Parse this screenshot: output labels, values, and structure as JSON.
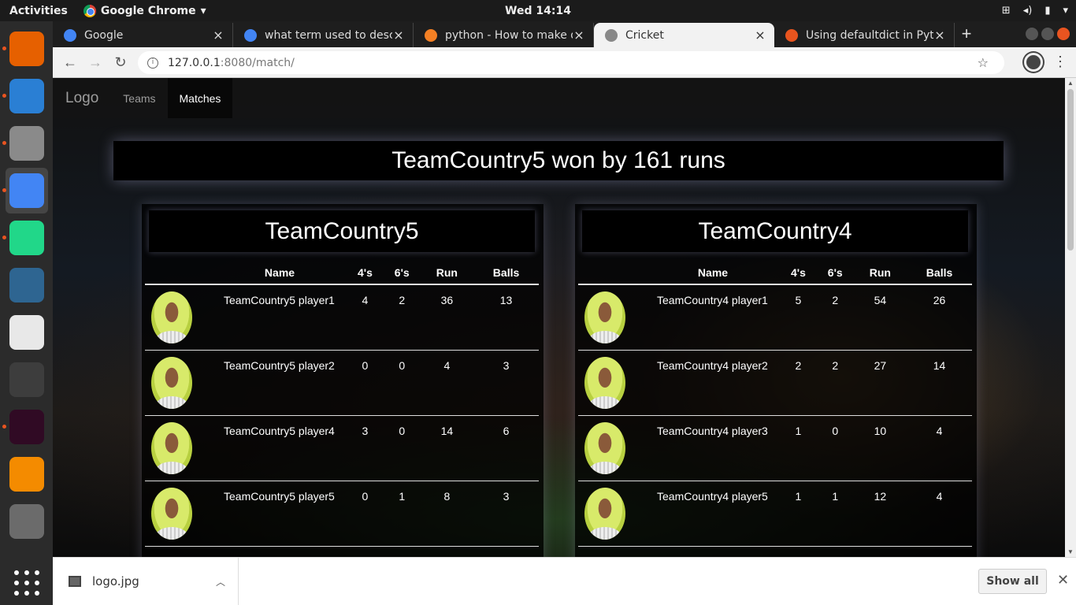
{
  "os": {
    "activities": "Activities",
    "app_menu": "Google Chrome",
    "app_menu_caret": "▾",
    "clock": "Wed 14:14"
  },
  "dock": {
    "items": [
      {
        "name": "firefox",
        "color": "#e66000",
        "active": false
      },
      {
        "name": "thunderbird",
        "color": "#2a7fd4",
        "active": false
      },
      {
        "name": "files",
        "color": "#8a8a8a",
        "active": false
      },
      {
        "name": "chrome",
        "color": "#4285f4",
        "active": true
      },
      {
        "name": "pycharm",
        "color": "#21d789",
        "active": false
      },
      {
        "name": "mysql-workbench",
        "color": "#2e6591",
        "active": false
      },
      {
        "name": "evince",
        "color": "#e8e8e8",
        "active": false
      },
      {
        "name": "sublime-text",
        "color": "#3d3d3d",
        "active": false
      },
      {
        "name": "terminal",
        "color": "#300a24",
        "active": false
      },
      {
        "name": "vlc",
        "color": "#f48b00",
        "active": false
      },
      {
        "name": "text-editor",
        "color": "#6b6b6b",
        "active": false
      }
    ]
  },
  "browser": {
    "tabs": [
      {
        "title": "Google",
        "icon_color": "#4285f4",
        "active": false
      },
      {
        "title": "what term used to desc",
        "icon_color": "#4285f4",
        "active": false
      },
      {
        "title": "python - How to make di",
        "icon_color": "#f48024",
        "active": false
      },
      {
        "title": "Cricket",
        "icon_color": "#888888",
        "active": true
      },
      {
        "title": "Using defaultdict in Pyt",
        "icon_color": "#e8541e",
        "active": false
      }
    ],
    "close_glyph": "×",
    "new_tab_glyph": "+",
    "url_host": "127.0.0.1",
    "url_rest": ":8080/match/"
  },
  "site": {
    "brand": "Logo",
    "nav": [
      {
        "label": "Teams",
        "active": false
      },
      {
        "label": "Matches",
        "active": true
      }
    ],
    "result": "TeamCountry5 won by 161 runs",
    "columns": {
      "name": "Name",
      "fours": "4's",
      "sixes": "6's",
      "runs": "Run",
      "balls": "Balls"
    },
    "teams": [
      {
        "name": "TeamCountry5",
        "players": [
          {
            "name": "TeamCountry5 player1",
            "fours": "4",
            "sixes": "2",
            "runs": "36",
            "balls": "13"
          },
          {
            "name": "TeamCountry5 player2",
            "fours": "0",
            "sixes": "0",
            "runs": "4",
            "balls": "3"
          },
          {
            "name": "TeamCountry5 player4",
            "fours": "3",
            "sixes": "0",
            "runs": "14",
            "balls": "6"
          },
          {
            "name": "TeamCountry5 player5",
            "fours": "0",
            "sixes": "1",
            "runs": "8",
            "balls": "3"
          }
        ]
      },
      {
        "name": "TeamCountry4",
        "players": [
          {
            "name": "TeamCountry4 player1",
            "fours": "5",
            "sixes": "2",
            "runs": "54",
            "balls": "26"
          },
          {
            "name": "TeamCountry4 player2",
            "fours": "2",
            "sixes": "2",
            "runs": "27",
            "balls": "14"
          },
          {
            "name": "TeamCountry4 player3",
            "fours": "1",
            "sixes": "0",
            "runs": "10",
            "balls": "4"
          },
          {
            "name": "TeamCountry4 player5",
            "fours": "1",
            "sixes": "1",
            "runs": "12",
            "balls": "4"
          }
        ]
      }
    ]
  },
  "downloads": {
    "file": "logo.jpg",
    "show_all": "Show all"
  }
}
